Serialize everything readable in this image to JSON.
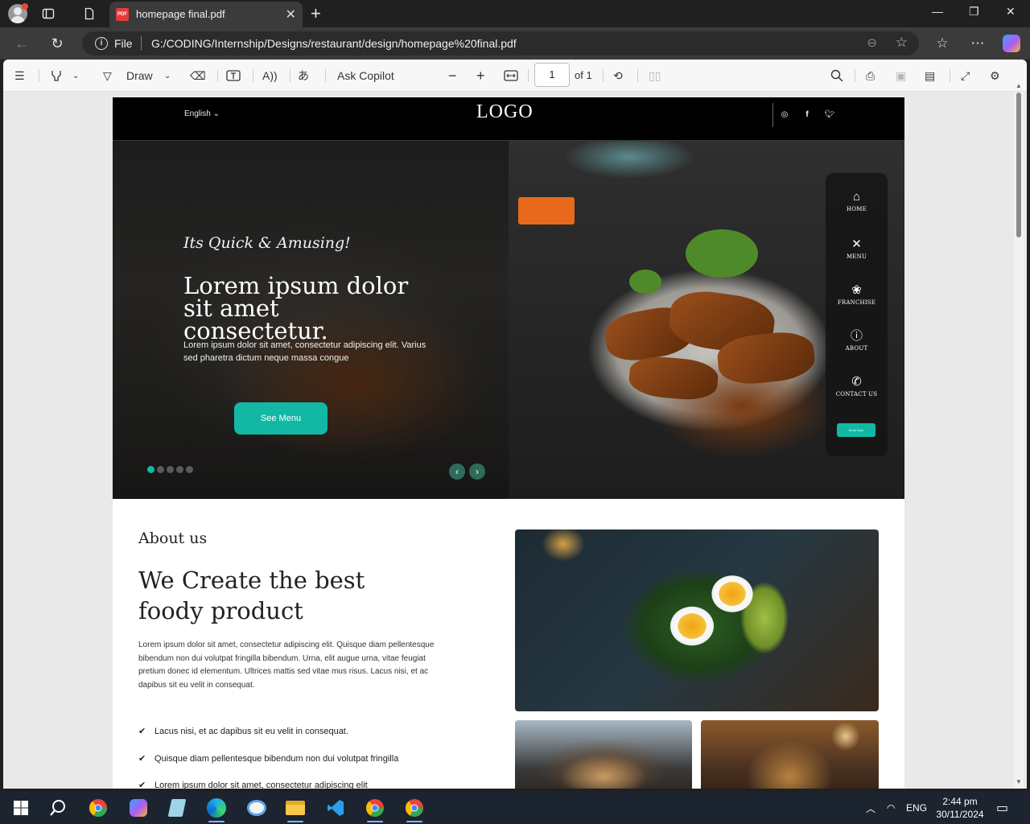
{
  "browser": {
    "tab_title": "homepage final.pdf",
    "address_scheme": "File",
    "address_url": "G:/CODING/Internship/Designs/restaurant/design/homepage%20final.pdf"
  },
  "pdf_toolbar": {
    "draw_label": "Draw",
    "ask_copilot_label": "Ask Copilot",
    "current_page": "1",
    "page_count": "of 1"
  },
  "site": {
    "language": "English",
    "logo": "LOGO",
    "hero": {
      "tagline": "Its Quick & Amusing!",
      "title": "Lorem ipsum dolor sit amet consectetur.",
      "text": "Lorem ipsum dolor sit amet, consectetur adipiscing elit. Varius sed pharetra dictum neque massa congue",
      "cta": "See Menu",
      "slides": 5,
      "active_slide": 1
    },
    "side_nav": [
      {
        "label": "HOME",
        "icon": "home-icon",
        "glyph": "⌂"
      },
      {
        "label": "MENU",
        "icon": "utensils-icon",
        "glyph": "✕"
      },
      {
        "label": "FRANCHISE",
        "icon": "franchise-icon",
        "glyph": "❀"
      },
      {
        "label": "ABOUT",
        "icon": "info-icon",
        "glyph": "ⓘ"
      },
      {
        "label": "CONTACT US",
        "icon": "phone-icon",
        "glyph": "✆"
      }
    ],
    "book_now": "Book Now",
    "about": {
      "eyebrow": "About us",
      "heading": "We Create the best foody product",
      "body": "Lorem ipsum dolor sit amet, consectetur adipiscing elit. Quisque diam pellentesque bibendum non dui volutpat fringilla bibendum. Urna, elit augue urna, vitae feugiat pretium donec id elementum. Ultrices mattis sed vitae mus risus. Lacus nisi, et ac dapibus sit eu velit in consequat.",
      "checklist": [
        "Lacus nisi, et ac dapibus sit eu velit in consequat.",
        "Quisque diam pellentesque bibendum non dui volutpat fringilla",
        "Lorem ipsum dolor sit amet, consectetur adipiscing elit"
      ]
    }
  },
  "taskbar": {
    "language": "ENG",
    "time": "2:44 pm",
    "date": "30/11/2024"
  },
  "colors": {
    "accent": "#13b8a5",
    "browser_dark": "#202020",
    "taskbar": "#1c2430"
  }
}
